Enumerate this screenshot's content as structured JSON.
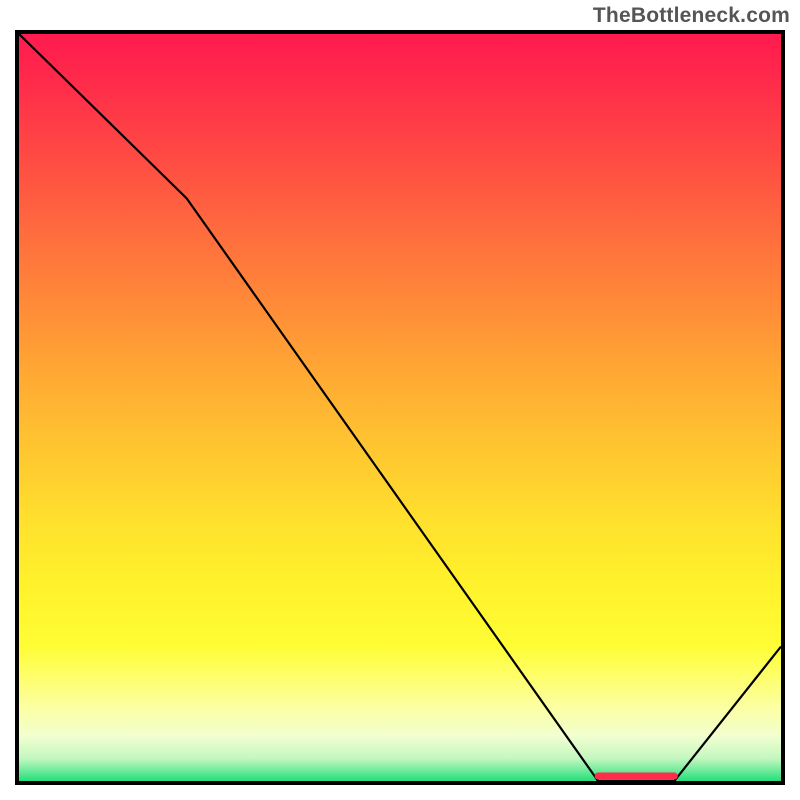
{
  "attribution": "TheBottleneck.com",
  "chart_data": {
    "type": "line",
    "title": "",
    "xlabel": "",
    "ylabel": "",
    "xlim": [
      0,
      100
    ],
    "ylim": [
      0,
      100
    ],
    "x": [
      0,
      22,
      76,
      86,
      100
    ],
    "y": [
      100,
      78,
      0,
      0,
      18
    ],
    "marker": {
      "x_start": 76,
      "x_end": 86,
      "y": 0,
      "color": "#ff2d4a"
    },
    "gradient_stops": [
      {
        "pos": 0,
        "color": "#ff1a4f"
      },
      {
        "pos": 7,
        "color": "#ff2d4a"
      },
      {
        "pos": 16,
        "color": "#ff4944"
      },
      {
        "pos": 26,
        "color": "#ff6a3e"
      },
      {
        "pos": 36,
        "color": "#ff8a38"
      },
      {
        "pos": 46,
        "color": "#ffaa33"
      },
      {
        "pos": 56,
        "color": "#ffc730"
      },
      {
        "pos": 66,
        "color": "#ffe22d"
      },
      {
        "pos": 74,
        "color": "#fff22c"
      },
      {
        "pos": 82,
        "color": "#fffd35"
      },
      {
        "pos": 90,
        "color": "#fcffa0"
      },
      {
        "pos": 94,
        "color": "#f2ffd0"
      },
      {
        "pos": 97,
        "color": "#c3f7c0"
      },
      {
        "pos": 100,
        "color": "#23e07a"
      }
    ]
  },
  "plot": {
    "inner_width": 762,
    "inner_height": 747
  }
}
